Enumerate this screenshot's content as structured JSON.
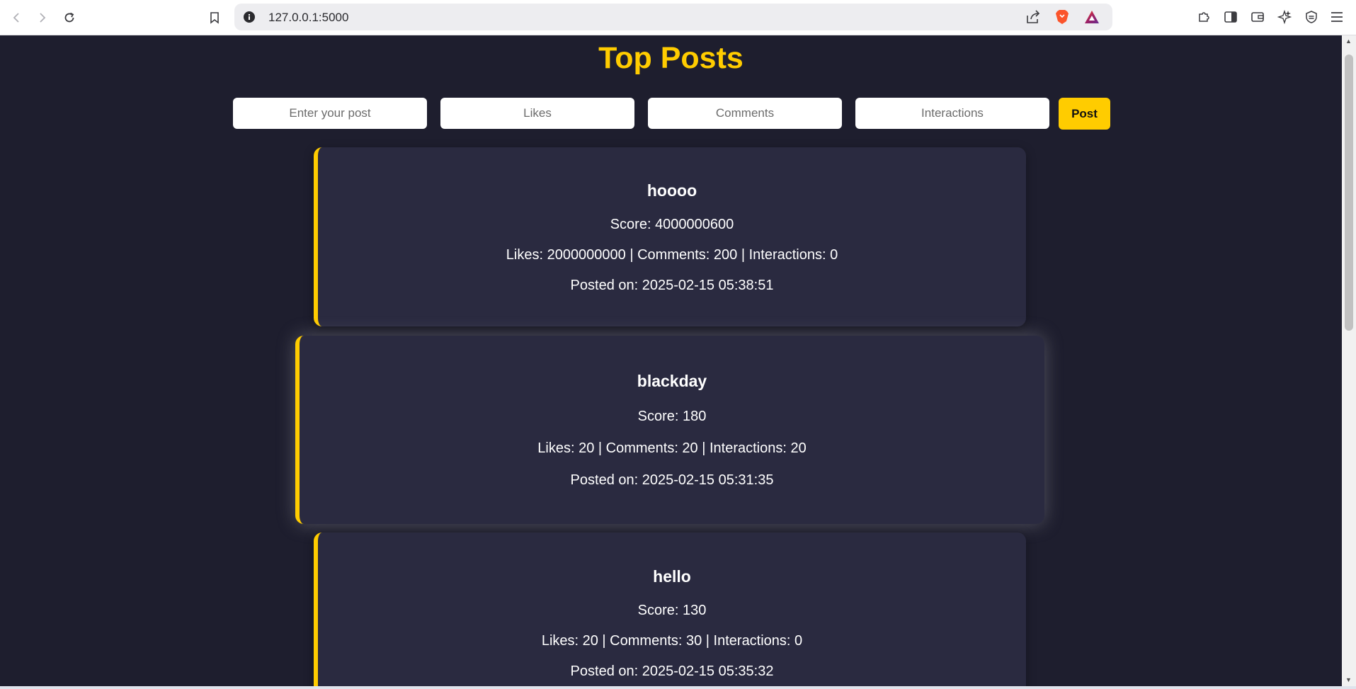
{
  "browser": {
    "url": "127.0.0.1:5000"
  },
  "page": {
    "title": "Top Posts"
  },
  "form": {
    "post_placeholder": "Enter your post",
    "likes_placeholder": "Likes",
    "comments_placeholder": "Comments",
    "interactions_placeholder": "Interactions",
    "submit_label": "Post"
  },
  "posts": [
    {
      "title": "hoooo",
      "score": "Score: 4000000600",
      "stats": "Likes: 2000000000 | Comments: 200 | Interactions: 0",
      "posted": "Posted on: 2025-02-15 05:38:51"
    },
    {
      "title": "blackday",
      "score": "Score: 180",
      "stats": "Likes: 20 | Comments: 20 | Interactions: 20",
      "posted": "Posted on: 2025-02-15 05:31:35"
    },
    {
      "title": "hello",
      "score": "Score: 130",
      "stats": "Likes: 20 | Comments: 30 | Interactions: 0",
      "posted": "Posted on: 2025-02-15 05:35:32"
    }
  ],
  "colors": {
    "accent": "#ffcc00",
    "background": "#1e1e2e",
    "card": "#2a2a40"
  },
  "icons": {
    "nav": [
      "back-arrow-icon",
      "forward-arrow-icon",
      "reload-icon",
      "bookmark-icon"
    ],
    "address": [
      "site-info-icon",
      "share-icon",
      "brave-shield-icon",
      "brave-rewards-icon"
    ],
    "toolbar": [
      "extensions-icon",
      "sidebar-icon",
      "wallet-icon",
      "leo-ai-icon",
      "vpn-icon",
      "menu-icon"
    ]
  }
}
